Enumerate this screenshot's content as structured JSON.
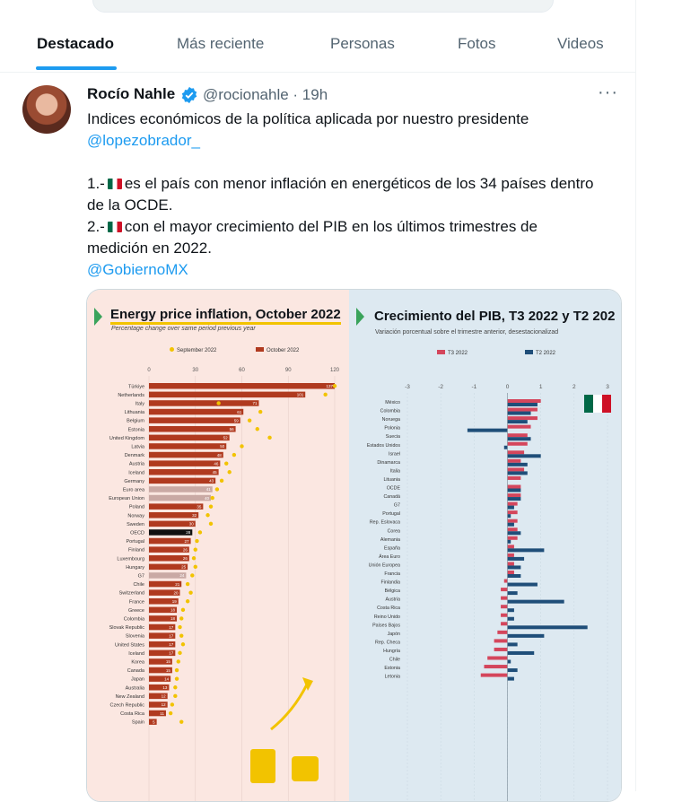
{
  "tabs": [
    "Destacado",
    "Más reciente",
    "Personas",
    "Fotos",
    "Videos"
  ],
  "tweet": {
    "author_name": "Rocío Nahle",
    "handle_time": "@rocionahle · 19h",
    "more_icon": "···",
    "line1": "Indices económicos de la política aplicada por nuestro presidente",
    "mention": "@lopezobrador_",
    "item1a": "1.-",
    "item1b": "es el país con menor inflación en energéticos de los 34 países dentro",
    "item1c": "de la OCDE.",
    "item2a": "2.-",
    "item2b": "con el mayor crecimiento del PIB en los últimos trimestres de",
    "item2c": "medición en 2022.",
    "hashtag_link": "@GobiernoMX"
  },
  "colors": {
    "accent": "#1d9bf0",
    "oct_bar": "#b03a1f",
    "sept_dot": "#f2c300",
    "t3": "#d4465c",
    "t2": "#1f4e79"
  },
  "chart_data": [
    {
      "type": "bar",
      "title": "Energy price inflation, October 2022",
      "subtitle": "Percentage change over same period previous year",
      "series": [
        {
          "name": "September 2022"
        },
        {
          "name": "October 2022"
        }
      ],
      "xlim": [
        0,
        120
      ],
      "xticks": [
        "0",
        "30",
        "60",
        "90",
        "120"
      ],
      "categories": [
        "Türkiye",
        "Netherlands",
        "Italy",
        "Lithuania",
        "Belgium",
        "Estonia",
        "United Kingdom",
        "Latvia",
        "Denmark",
        "Austria",
        "Iceland",
        "Germany",
        "Euro area",
        "European Union",
        "Poland",
        "Norway",
        "Sweden",
        "OECD",
        "Portugal",
        "Finland",
        "Luxembourg",
        "Hungary",
        "G7",
        "Chile",
        "Switzerland",
        "France",
        "Greece",
        "Colombia",
        "Slovak Republic",
        "Slovenia",
        "United States",
        "Iceland",
        "Korea",
        "Canada",
        "Japan",
        "Australia",
        "New Zealand",
        "Czech Republic",
        "Costa Rica",
        "Spain"
      ],
      "values": [
        137,
        101,
        71,
        61,
        59,
        56,
        52,
        50,
        48,
        46,
        45,
        43,
        41,
        40,
        35,
        32,
        30,
        28,
        27,
        26,
        26,
        25,
        24,
        21,
        20,
        19,
        18,
        18,
        17,
        17,
        17,
        17,
        15,
        15,
        14,
        13,
        12,
        12,
        11,
        5
      ],
      "september": [
        120,
        114,
        45,
        72,
        65,
        70,
        78,
        60,
        55,
        50,
        52,
        47,
        44,
        41,
        40,
        38,
        40,
        33,
        31,
        30,
        29,
        30,
        28,
        25,
        27,
        25,
        22,
        21,
        20,
        21,
        22,
        20,
        19,
        18,
        18,
        17,
        17,
        15,
        14,
        21
      ]
    },
    {
      "type": "bar",
      "title": "Crecimiento del PIB, T3 2022 y T2 202",
      "subtitle": "Variación porcentual sobre el trimestre anterior, desestacionalizad",
      "series": [
        {
          "name": "T3 2022"
        },
        {
          "name": "T2 2022"
        }
      ],
      "xlim": [
        -3,
        3
      ],
      "xticks": [
        "-3",
        "-2",
        "-1",
        "0",
        "1",
        "2",
        "3"
      ],
      "categories": [
        "México",
        "Colombia",
        "Noruega",
        "Polonia",
        "Suecia",
        "Estados Unidos",
        "Israel",
        "Dinamarca",
        "Italia",
        "Lituania",
        "OCDE",
        "Canadá",
        "G7",
        "Portugal",
        "Rep. Eslovaca",
        "Corea",
        "Alemania",
        "España",
        "Área Euro",
        "Unión Europea",
        "Francia",
        "Finlandia",
        "Bélgica",
        "Austria",
        "Costa Rica",
        "Reino Unido",
        "Países Bajos",
        "Japón",
        "Rep. Checa",
        "Hungría",
        "Chile",
        "Estonia",
        "Letonia"
      ],
      "t3": [
        1.0,
        0.9,
        0.9,
        0.7,
        0.6,
        0.6,
        0.5,
        0.4,
        0.5,
        0.4,
        0.4,
        0.4,
        0.3,
        0.3,
        0.3,
        0.3,
        0.3,
        0.2,
        0.2,
        0.2,
        0.2,
        -0.1,
        -0.2,
        -0.2,
        -0.2,
        -0.2,
        -0.2,
        -0.3,
        -0.4,
        -0.4,
        -0.6,
        -0.7,
        -0.8
      ],
      "t2": [
        0.9,
        0.7,
        0.6,
        -1.2,
        0.7,
        -0.1,
        1.0,
        0.6,
        0.6,
        0.0,
        0.4,
        0.4,
        0.2,
        0.1,
        0.2,
        0.4,
        0.1,
        1.1,
        0.5,
        0.4,
        0.4,
        0.9,
        0.3,
        1.7,
        0.2,
        0.2,
        2.4,
        1.1,
        0.3,
        0.8,
        0.1,
        0.3,
        0.2
      ]
    }
  ]
}
